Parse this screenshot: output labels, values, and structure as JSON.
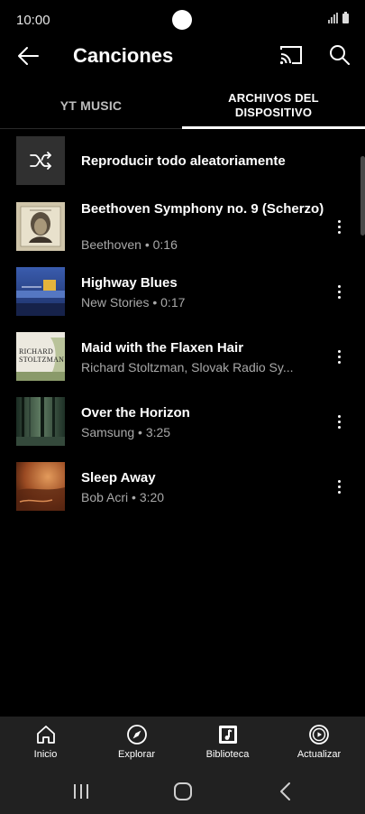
{
  "status_bar": {
    "time": "10:00"
  },
  "app_bar": {
    "title": "Canciones"
  },
  "tabs": [
    {
      "label": "YT MUSIC",
      "selected": false
    },
    {
      "label": "ARCHIVOS DEL DISPOSITIVO",
      "selected": true
    }
  ],
  "shuffle": {
    "label": "Reproducir todo aleatoriamente",
    "icon": "shuffle-icon"
  },
  "songs": [
    {
      "title": "Beethoven Symphony no. 9 (Scherzo)",
      "subtitle": "Beethoven • 0:16"
    },
    {
      "title": "Highway Blues",
      "subtitle": "New Stories • 0:17"
    },
    {
      "title": "Maid with the Flaxen Hair",
      "subtitle": "Richard Stoltzman, Slovak Radio Sy..."
    },
    {
      "title": "Over the Horizon",
      "subtitle": "Samsung • 3:25"
    },
    {
      "title": "Sleep Away",
      "subtitle": "Bob Acri • 3:20"
    }
  ],
  "album_art_text": {
    "maid": "RICHARD STOLTZMAN"
  },
  "bottom_nav": [
    {
      "label": "Inicio",
      "icon": "home-icon"
    },
    {
      "label": "Explorar",
      "icon": "compass-icon"
    },
    {
      "label": "Biblioteca",
      "icon": "library-icon"
    },
    {
      "label": "Actualizar",
      "icon": "upgrade-icon"
    }
  ],
  "colors": {
    "background": "#000000",
    "nav_background": "#212121",
    "secondary_text": "#a8a8a8"
  }
}
